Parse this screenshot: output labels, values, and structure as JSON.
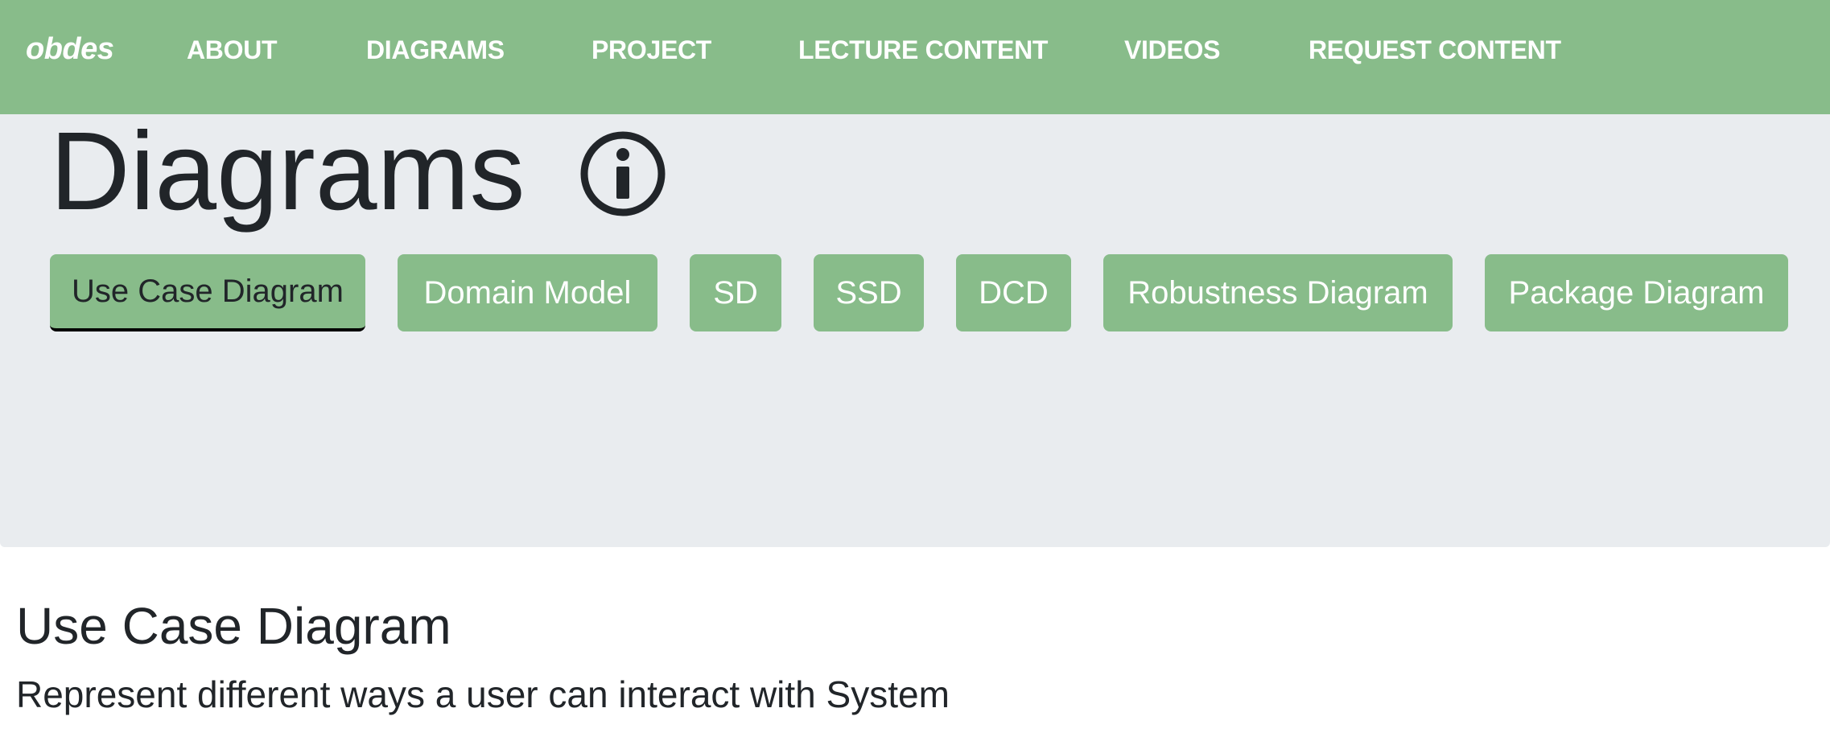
{
  "navbar": {
    "brand": "obdes",
    "links": [
      "ABOUT",
      "DIAGRAMS",
      "PROJECT",
      "LECTURE CONTENT",
      "VIDEOS",
      "REQUEST CONTENT"
    ],
    "background_color": "#88bc8a"
  },
  "header": {
    "title": "Diagrams",
    "info_icon": "info-circle-icon"
  },
  "diagram_tabs": {
    "items": [
      "Use Case Diagram",
      "Domain Model",
      "SD",
      "SSD",
      "DCD",
      "Robustness Diagram",
      "Package Diagram"
    ],
    "selected": "Use Case Diagram",
    "button_color": "#88bc8a"
  },
  "content": {
    "title": "Use Case Diagram",
    "description": "Represent different ways a user can interact with System"
  }
}
